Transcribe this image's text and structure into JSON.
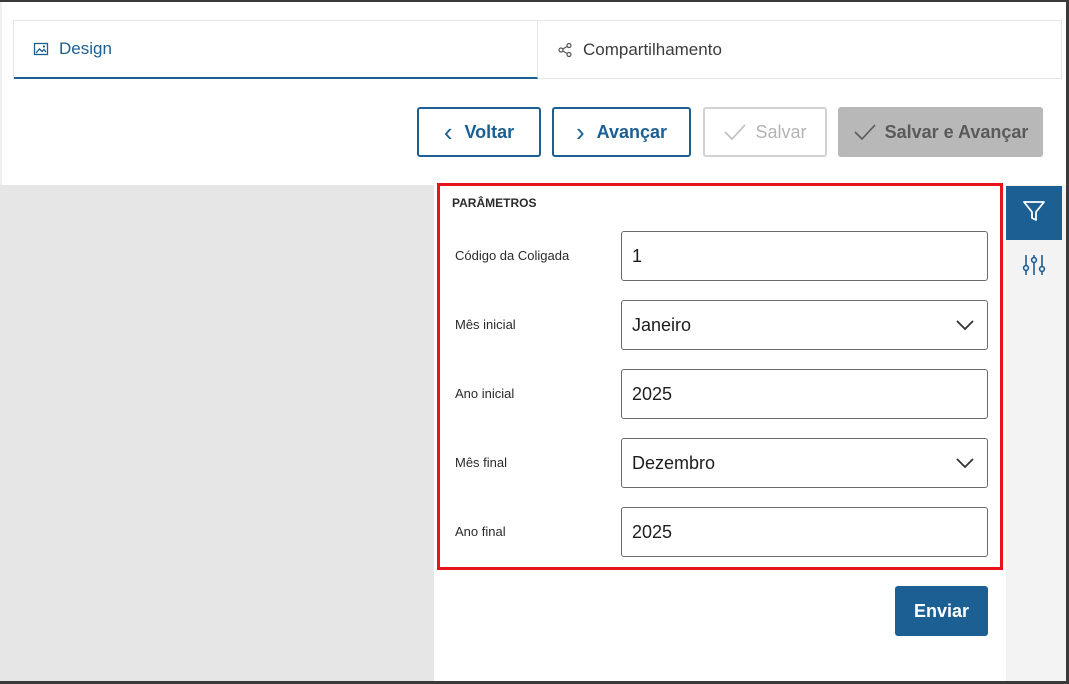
{
  "tabs": [
    {
      "label": "Design",
      "icon": "image-icon",
      "active": true
    },
    {
      "label": "Compartilhamento",
      "icon": "share-icon",
      "active": false
    }
  ],
  "toolbar": {
    "back_label": "Voltar",
    "next_label": "Avançar",
    "save_label": "Salvar",
    "save_next_label": "Salvar e Avançar"
  },
  "params": {
    "title": "PARÂMETROS",
    "fields": [
      {
        "label": "Código da Coligada",
        "value": "1",
        "type": "text"
      },
      {
        "label": "Mês inicial",
        "value": "Janeiro",
        "type": "select"
      },
      {
        "label": "Ano inicial",
        "value": "2025",
        "type": "text"
      },
      {
        "label": "Mês final",
        "value": "Dezembro",
        "type": "select"
      },
      {
        "label": "Ano final",
        "value": "2025",
        "type": "text"
      }
    ],
    "submit_label": "Enviar"
  },
  "sidebar": {
    "icons": [
      "filter-icon",
      "sliders-icon"
    ]
  },
  "colors": {
    "primary": "#1b5f93",
    "highlight": "#e8141c",
    "disabled_bg": "#b8b8b8",
    "gray_area": "#e6e6e6"
  }
}
